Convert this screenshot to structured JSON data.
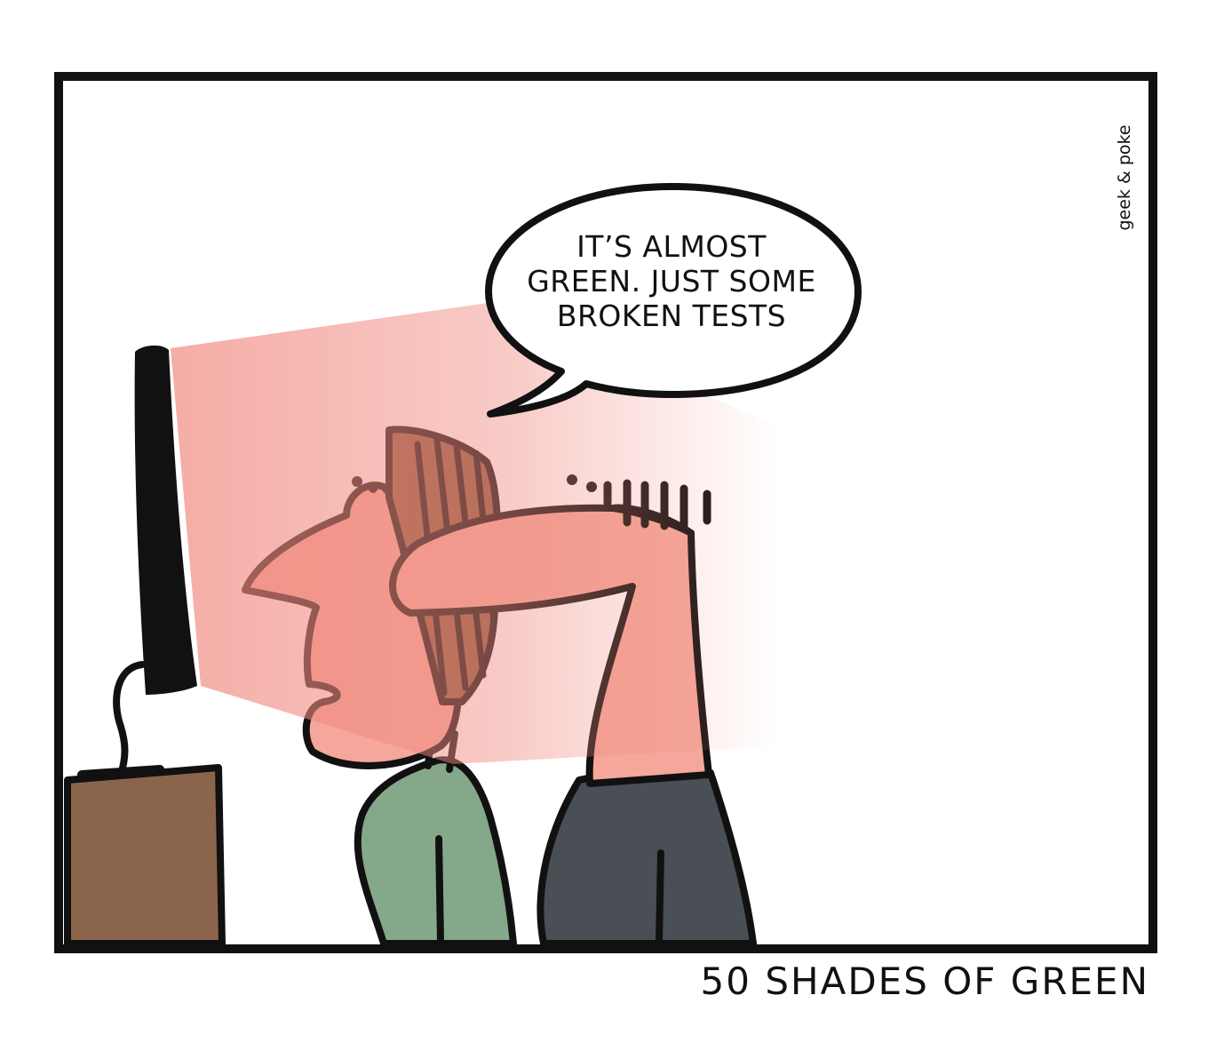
{
  "comic": {
    "speech_bubble": {
      "lines": [
        "IT’S ALMOST",
        "GREEN. JUST SOME",
        "BROKEN TESTS"
      ]
    },
    "signature": "geek & poke",
    "caption": "50 SHADES OF GREEN"
  },
  "colors": {
    "outline": "#111111",
    "skin": "#f4a79a",
    "hair": "#8a5a3c",
    "green_shirt": "#86a88a",
    "gray_shirt": "#4a4f55",
    "desk": "#8b654b",
    "screen_glow": "#f08a80"
  }
}
